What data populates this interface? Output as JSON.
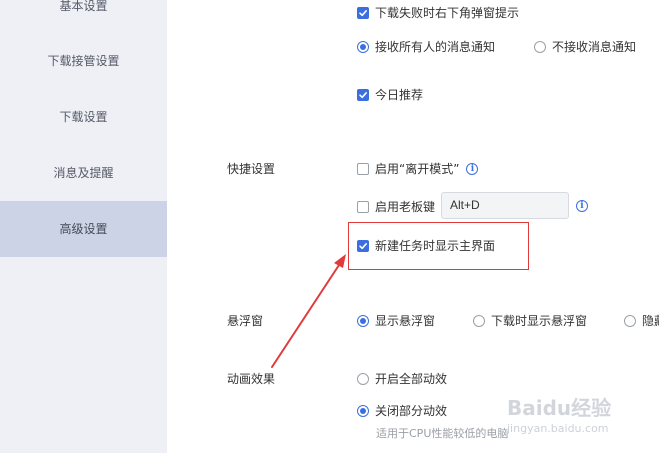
{
  "sidebar": {
    "items": [
      {
        "label": "基本设置",
        "active": false
      },
      {
        "label": "下载接管设置",
        "active": false
      },
      {
        "label": "下载设置",
        "active": false
      },
      {
        "label": "消息及提醒",
        "active": false
      },
      {
        "label": "高级设置",
        "active": true
      }
    ]
  },
  "messages": {
    "fail_popup": {
      "label": "下载失败时右下角弹窗提示",
      "checked": true
    },
    "notify_all": {
      "label": "接收所有人的消息通知",
      "selected": true
    },
    "notify_none": {
      "label": "不接收消息通知",
      "selected": false
    },
    "daily_recommend": {
      "label": "今日推荐",
      "checked": true
    }
  },
  "shortcuts": {
    "section_label": "快捷设置",
    "leave_mode": {
      "label": "启用“离开模式”",
      "checked": false
    },
    "boss_key": {
      "label": "启用老板键",
      "checked": false,
      "hotkey_value": "Alt+D"
    },
    "show_main": {
      "label": "新建任务时显示主界面",
      "checked": true
    }
  },
  "float_window": {
    "section_label": "悬浮窗",
    "options": [
      {
        "label": "显示悬浮窗",
        "selected": true
      },
      {
        "label": "下载时显示悬浮窗",
        "selected": false
      },
      {
        "label": "隐藏",
        "selected": false
      }
    ]
  },
  "animation": {
    "section_label": "动画效果",
    "enable_all": {
      "label": "开启全部动效",
      "selected": false
    },
    "disable_some": {
      "label": "关闭部分动效",
      "selected": true
    },
    "hint": "适用于CPU性能较低的电脑"
  },
  "watermark": {
    "brand": "Baidu经验",
    "url": "jingyan.baidu.com"
  },
  "colors": {
    "accent": "#3b6fe0",
    "sidebar_bg": "#eef0f6",
    "sidebar_active": "#ccd3e6",
    "annotation_red": "#e03a3a"
  },
  "icons": {
    "check": "checkmark-icon",
    "info": "info-icon",
    "arrow": "annotation-arrow"
  }
}
